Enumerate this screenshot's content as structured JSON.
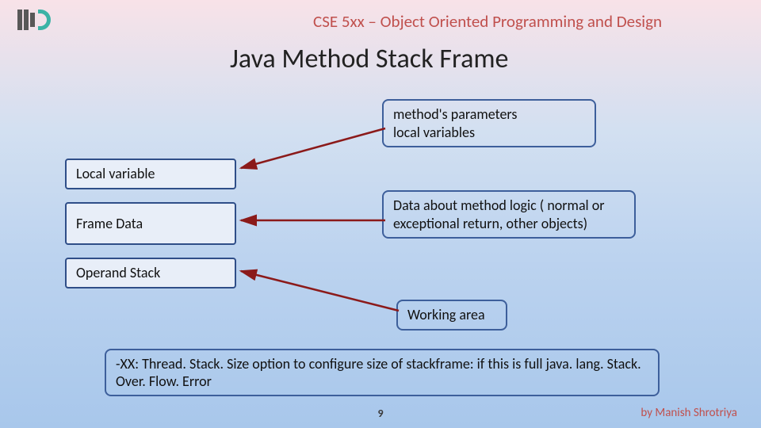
{
  "course": "CSE 5xx – Object Oriented Programming and Design",
  "title": "Java Method Stack Frame",
  "left": {
    "localvar": "Local variable",
    "framedata": "Frame Data",
    "opstack": "Operand Stack"
  },
  "right": {
    "localvar_desc": "method's parameters\nlocal variables",
    "framedata_desc": "Data about method logic ( normal or exceptional return, other objects)",
    "opstack_desc": "Working area"
  },
  "note": "-XX: Thread. Stack. Size option to configure size of stackframe: if this is full java. lang. Stack. Over. Flow. Error",
  "page": "9",
  "author": "by Manish Shrotriya",
  "colors": {
    "accent": "#c0504d",
    "box_border": "#3d5f9b"
  }
}
